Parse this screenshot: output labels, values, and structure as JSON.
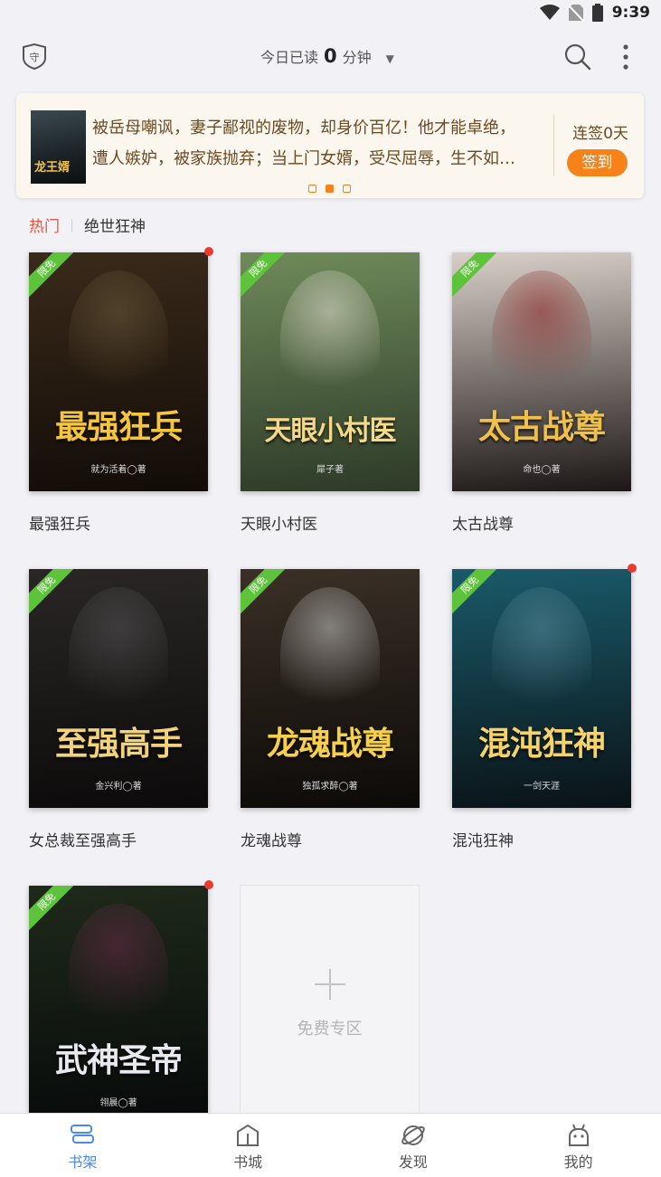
{
  "status_bar": {
    "time": "9:39"
  },
  "header": {
    "reading_prefix": "今日已读",
    "reading_minutes": "0",
    "reading_suffix": "分钟"
  },
  "banner": {
    "cover_title": "龙王婿",
    "line1": "被岳母嘲讽，妻子鄙视的废物，却身价百亿！他才能卓绝，",
    "line2": "遭人嫉妒，被家族抛弃；当上门女婿，受尽屈辱，生不如…",
    "checkin_count": "连签0天",
    "checkin_button": "签到"
  },
  "tabs": {
    "hot": "热门",
    "other": "绝世狂神"
  },
  "books": [
    {
      "title": "最强狂兵",
      "cover_text": "最强狂兵",
      "author": "就为活着◯著",
      "tag": "限免",
      "colors": [
        "#3a2a1a",
        "#120c08"
      ],
      "title_color": "#f5c53c",
      "figure_color": "#6b5a3a"
    },
    {
      "title": "天眼小村医",
      "cover_text": "天眼小村医",
      "author": "犀子著",
      "tag": "限免",
      "colors": [
        "#6f8a5a",
        "#2d3a28"
      ],
      "title_color": "#f4d98a",
      "figure_color": "#e6e0d4"
    },
    {
      "title": "太古战尊",
      "cover_text": "太古战尊",
      "author": "命也◯著",
      "tag": "限免",
      "colors": [
        "#d8d0c8",
        "#1c1616"
      ],
      "title_color": "#f0c048",
      "figure_color": "#8a2020"
    },
    {
      "title": "女总裁至强高手",
      "cover_text": "至强高手",
      "author": "金兴利◯著",
      "tag": "限免",
      "colors": [
        "#2a2626",
        "#0c0a0a"
      ],
      "title_color": "#f2d27a",
      "figure_color": "#555"
    },
    {
      "title": "龙魂战尊",
      "cover_text": "龙魂战尊",
      "author": "独孤求醉◯著",
      "tag": "限免",
      "colors": [
        "#3a3026",
        "#0c0a08"
      ],
      "title_color": "#f6d04a",
      "figure_color": "#c8c8c8"
    },
    {
      "title": "混沌狂神",
      "cover_text": "混沌狂神",
      "author": "一剑天涯",
      "tag": "限免",
      "colors": [
        "#1a5a6a",
        "#0a1216"
      ],
      "title_color": "#f6d26a",
      "figure_color": "#5a8a9a"
    },
    {
      "title": "",
      "cover_text": "武神圣帝",
      "author": "翎晨◯著",
      "tag": "限免",
      "colors": [
        "#1e2a1a",
        "#07090a"
      ],
      "title_color": "#e8e8ee",
      "figure_color": "#6a2a4a"
    }
  ],
  "add_tile": {
    "label": "免费专区"
  },
  "bottom_nav": [
    {
      "label": "书架",
      "icon": "bookshelf-icon",
      "active": true
    },
    {
      "label": "书城",
      "icon": "store-icon",
      "active": false
    },
    {
      "label": "发现",
      "icon": "planet-icon",
      "active": false
    },
    {
      "label": "我的",
      "icon": "profile-icon",
      "active": false
    }
  ],
  "colors": {
    "accent": "#f7821a",
    "nav_active": "#4a8be8",
    "hot": "#e8553f",
    "free_tag": "#5cc33a"
  }
}
